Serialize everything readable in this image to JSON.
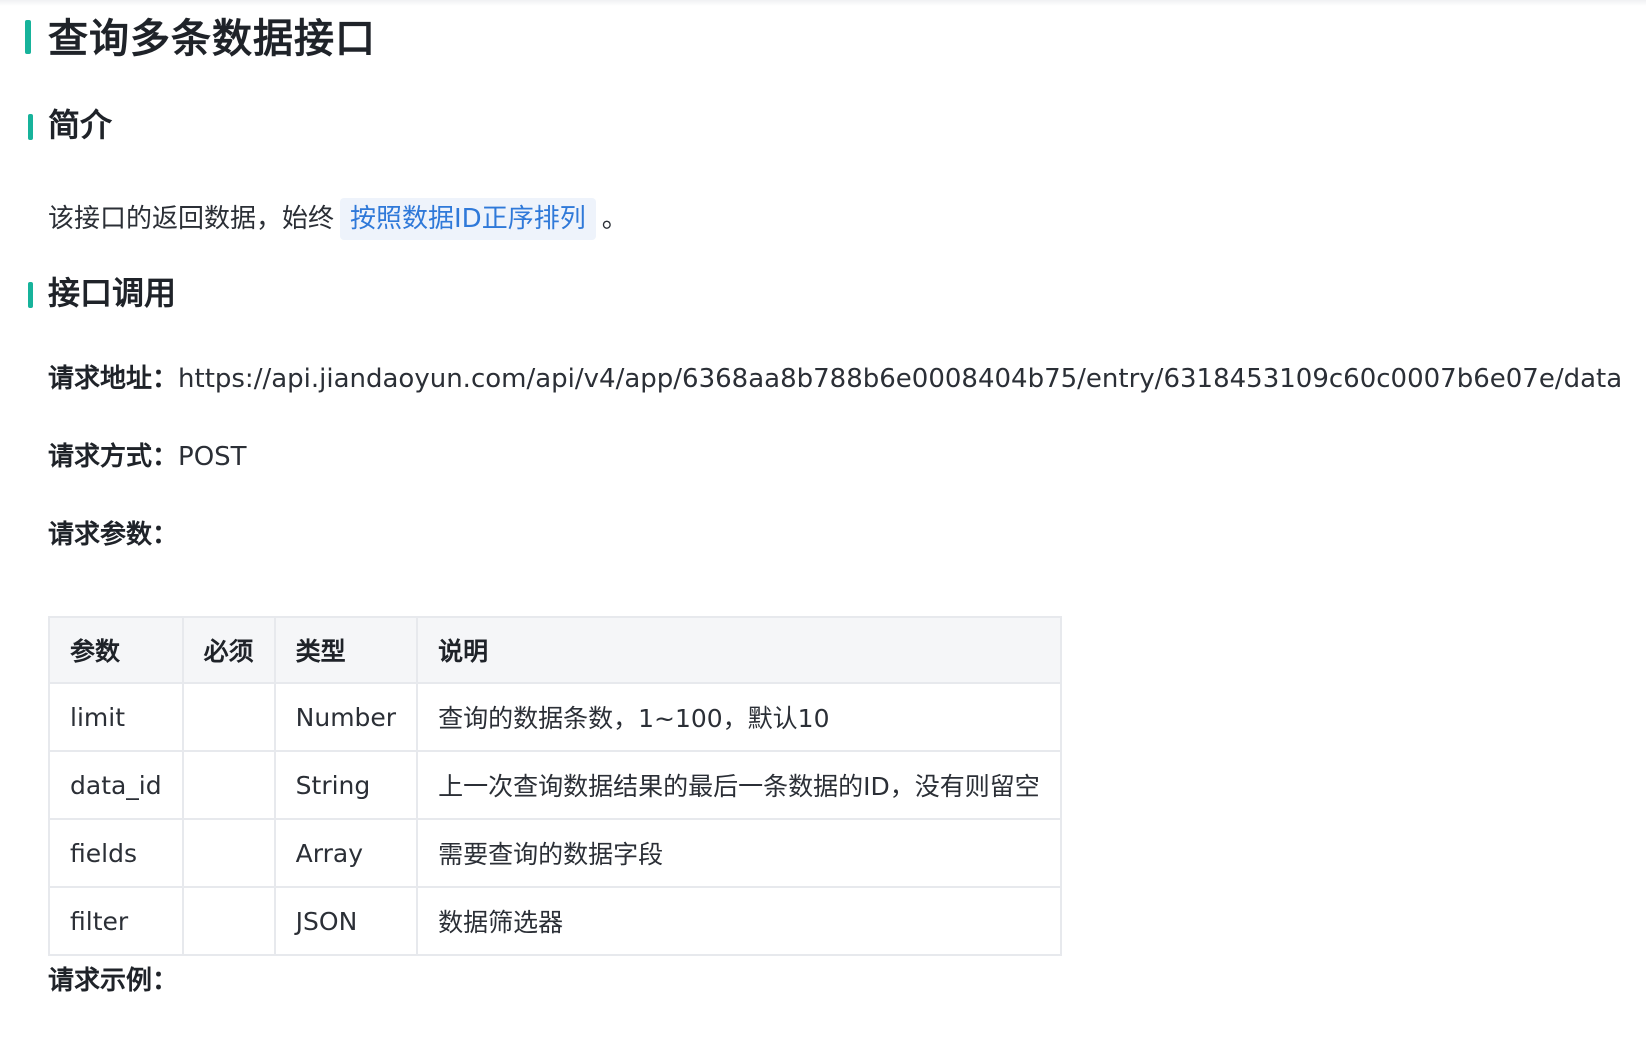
{
  "title": "查询多条数据接口",
  "intro": {
    "heading": "简介",
    "text_before": "该接口的返回数据，始终",
    "highlight": "按照数据ID正序排列",
    "text_after": "。"
  },
  "api_call": {
    "heading": "接口调用",
    "url_label": "请求地址：",
    "url": "https://api.jiandaoyun.com/api/v4/app/6368aa8b788b6e0008404b75/entry/6318453109c60c0007b6e07e/data",
    "method_label": "请求方式：",
    "method": "POST",
    "params_label": "请求参数：",
    "example_label": "请求示例："
  },
  "params_table": {
    "headers": [
      "参数",
      "必须",
      "类型",
      "说明"
    ],
    "rows": [
      [
        "limit",
        "",
        "Number",
        "查询的数据条数，1~100，默认10"
      ],
      [
        "data_id",
        "",
        "String",
        "上一次查询数据结果的最后一条数据的ID，没有则留空"
      ],
      [
        "fields",
        "",
        "Array",
        "需要查询的数据字段"
      ],
      [
        "filter",
        "",
        "JSON",
        "数据筛选器"
      ]
    ]
  },
  "colors": {
    "accent": "#17b39b",
    "highlight_text": "#2f79d9",
    "highlight_bg": "#eef3fb"
  }
}
